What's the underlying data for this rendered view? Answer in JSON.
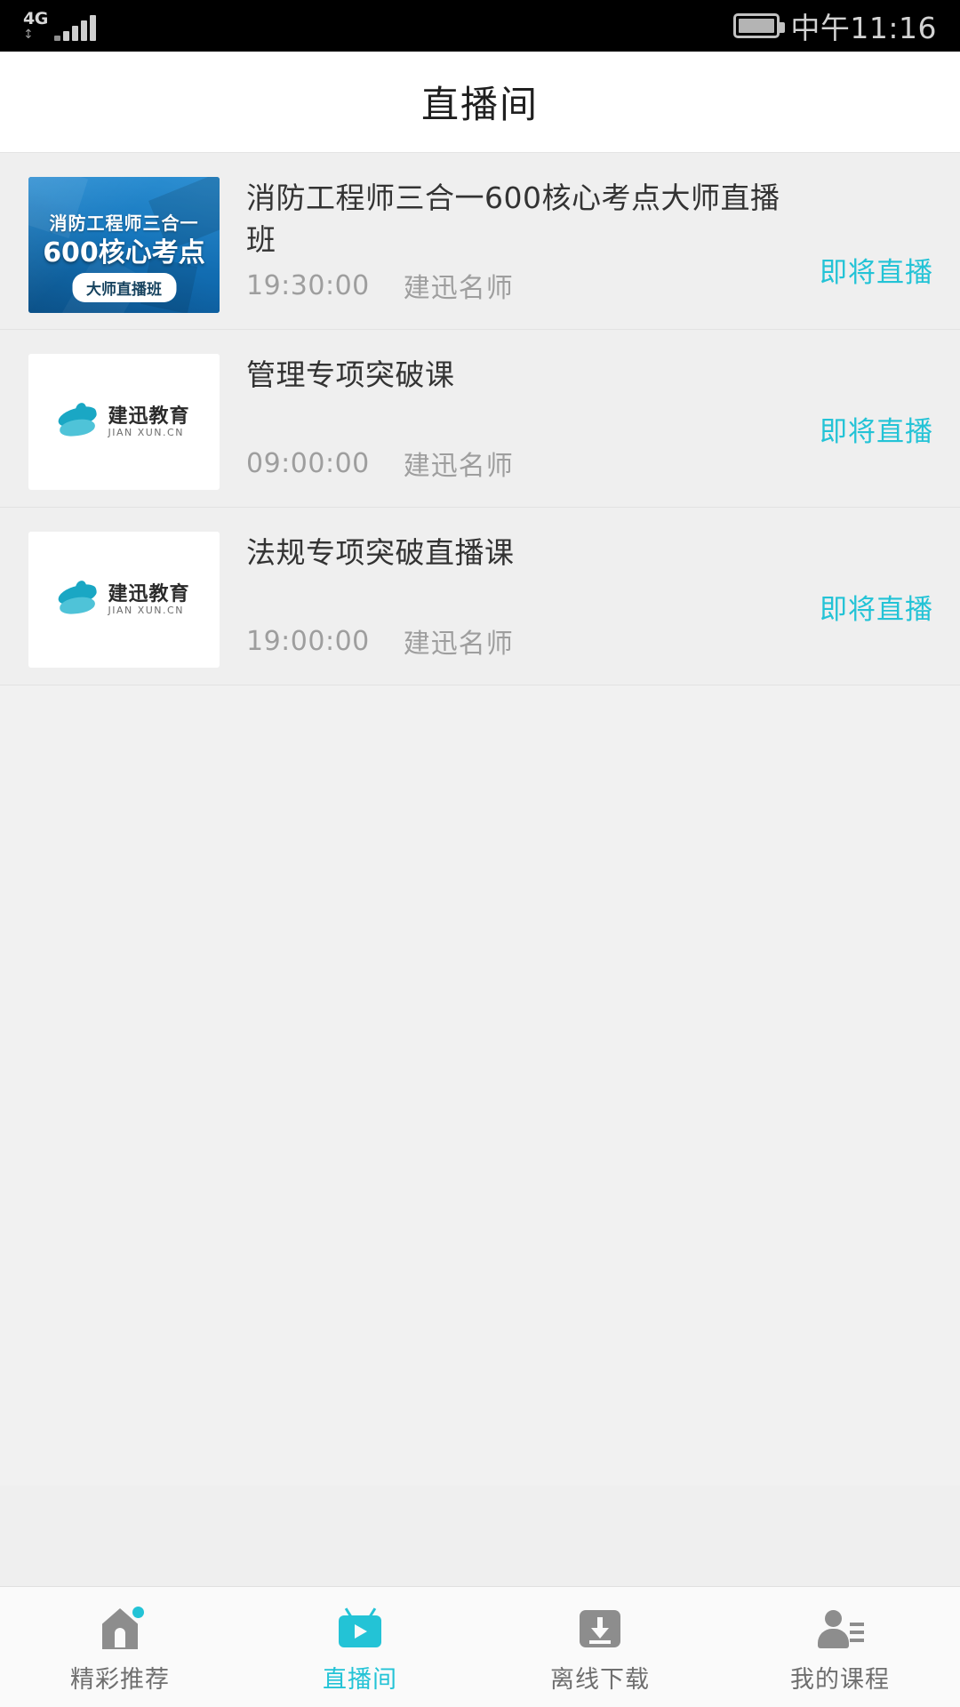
{
  "statusbar": {
    "network_label": "4G",
    "network_arrows": "↕",
    "clock": "中午11:16",
    "signal_icon": "signal-bars-icon",
    "battery_icon": "battery-full-icon"
  },
  "header": {
    "title": "直播间"
  },
  "accent_color": "#23c3d6",
  "list": {
    "items": [
      {
        "title": "消防工程师三合一600核心考点大师直播班",
        "status": "即将直播",
        "time": "19:30:00",
        "teacher": "建迅名师",
        "thumb_type": "poster",
        "poster": {
          "line1": "消防工程师三合一",
          "line2": "600核心考点",
          "badge": "大师直播班"
        }
      },
      {
        "title": "管理专项突破课",
        "status": "即将直播",
        "time": "09:00:00",
        "teacher": "建迅名师",
        "thumb_type": "logo",
        "logo": {
          "cn": "建迅教育",
          "en": "JIAN XUN.CN"
        }
      },
      {
        "title": "法规专项突破直播课",
        "status": "即将直播",
        "time": "19:00:00",
        "teacher": "建迅名师",
        "thumb_type": "logo",
        "logo": {
          "cn": "建迅教育",
          "en": "JIAN XUN.CN"
        }
      }
    ]
  },
  "tabbar": {
    "tabs": [
      {
        "label": "精彩推荐",
        "icon": "house-icon",
        "active": false
      },
      {
        "label": "直播间",
        "icon": "tv-icon",
        "active": true
      },
      {
        "label": "离线下载",
        "icon": "download-icon",
        "active": false
      },
      {
        "label": "我的课程",
        "icon": "person-icon",
        "active": false
      }
    ]
  }
}
